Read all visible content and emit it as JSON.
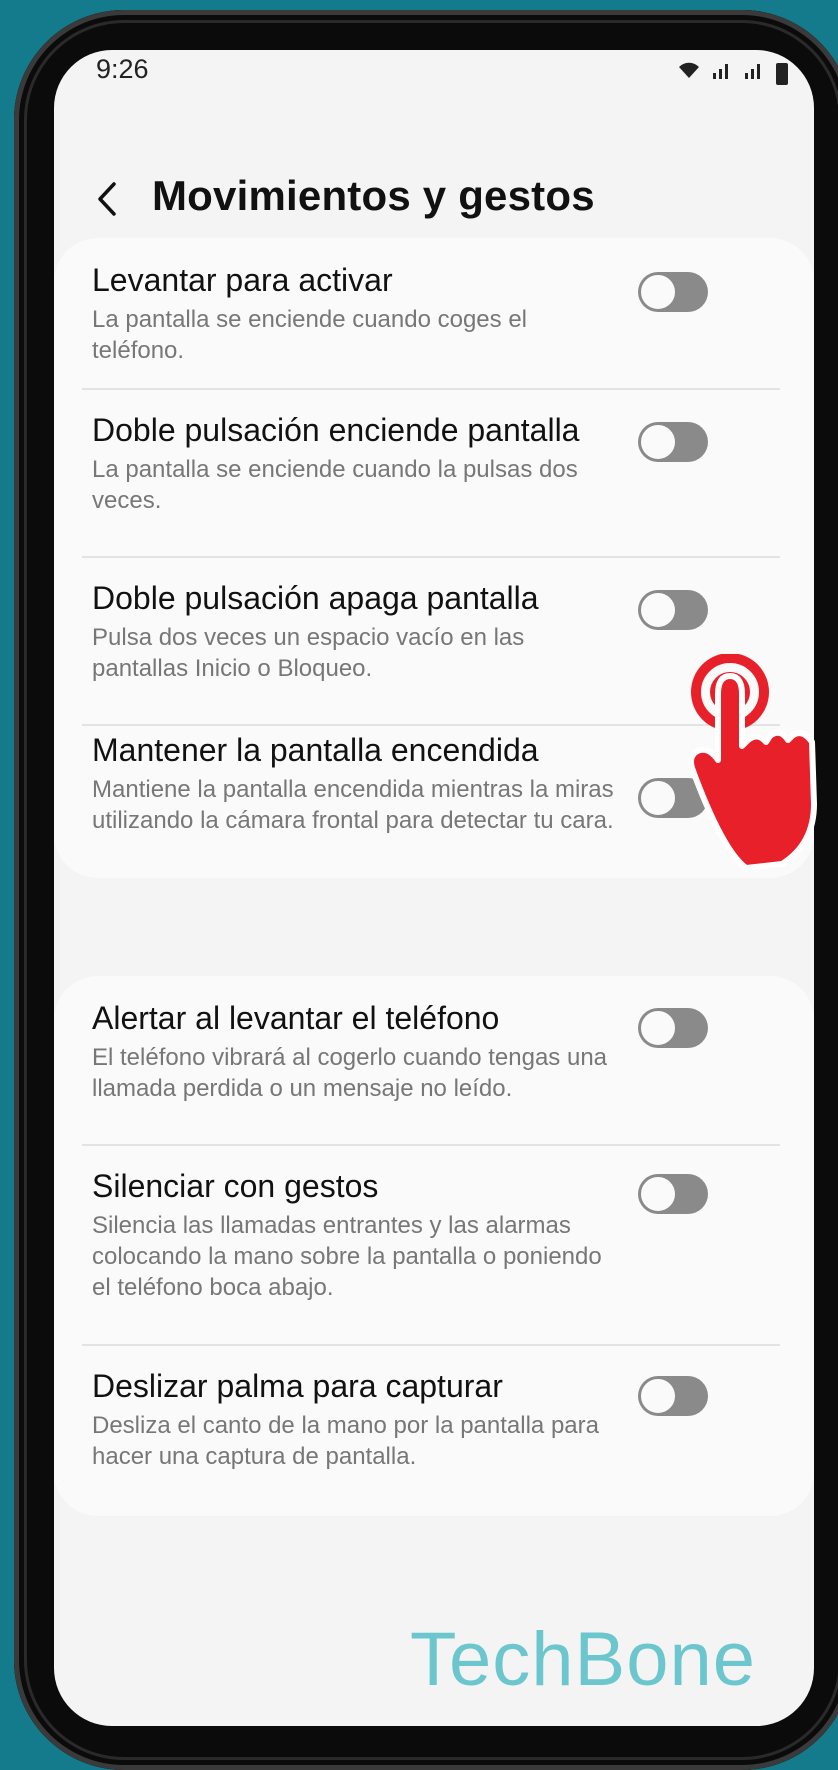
{
  "status_bar": {
    "time": "9:26"
  },
  "header": {
    "title": "Movimientos y gestos"
  },
  "group1": [
    {
      "title": "Levantar para activar",
      "description": "La pantalla se enciende cuando coges el teléfono.",
      "enabled": false
    },
    {
      "title": "Doble pulsación enciende pantalla",
      "description": "La pantalla se enciende cuando la pulsas dos veces.",
      "enabled": false
    },
    {
      "title": "Doble pulsación apaga pantalla",
      "description": "Pulsa dos veces un espacio vacío en las pantallas Inicio o Bloqueo.",
      "enabled": false
    },
    {
      "title": "Mantener la pantalla encendida",
      "description": "Mantiene la pantalla encendida mientras la miras utilizando la cámara frontal para detectar tu cara.",
      "enabled": false
    }
  ],
  "group2": [
    {
      "title": "Alertar al levantar el teléfono",
      "description": "El teléfono vibrará al cogerlo cuando tengas una llamada perdida o un mensaje no leído.",
      "enabled": false
    },
    {
      "title": "Silenciar con gestos",
      "description": "Silencia las llamadas entrantes y las alarmas colocando la mano sobre la pantalla o poniendo el teléfono boca abajo.",
      "enabled": false
    },
    {
      "title": "Deslizar palma para capturar",
      "description": "Desliza el canto de la mano por la pantalla para hacer una captura de pantalla.",
      "enabled": false
    }
  ],
  "watermark": "TechBone",
  "colors": {
    "background": "#137b8c",
    "toggle_off": "#8a8a8a",
    "tap_indicator": "#e8202a",
    "watermark": "#6cc6ce"
  }
}
